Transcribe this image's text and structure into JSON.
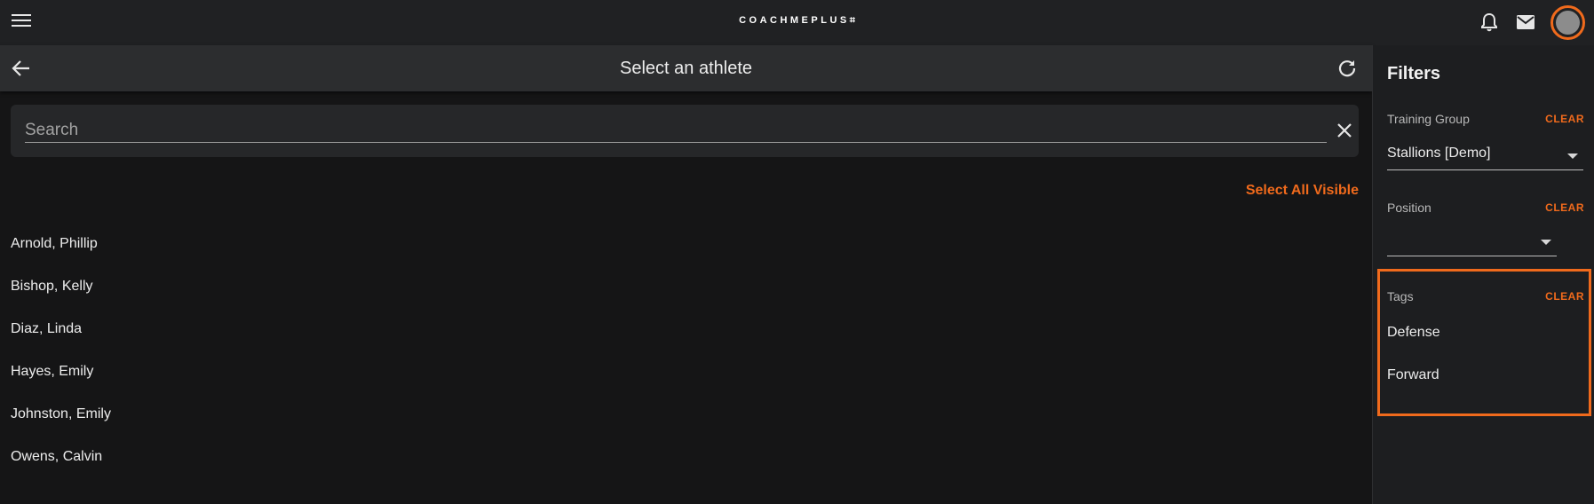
{
  "header": {
    "brand": "COACHMEPLUS",
    "brand_mark": "⌗",
    "icons": [
      "menu-icon",
      "bell-icon",
      "mail-icon",
      "avatar"
    ]
  },
  "subheader": {
    "title": "Select an athlete"
  },
  "search": {
    "placeholder": "Search",
    "value": ""
  },
  "select_all_label": "Select All Visible",
  "athletes": [
    "Arnold, Phillip",
    "Bishop, Kelly",
    "Diaz, Linda",
    "Hayes, Emily",
    "Johnston, Emily",
    "Owens, Calvin"
  ],
  "filters": {
    "title": "Filters",
    "clear_label": "CLEAR",
    "training_group": {
      "label": "Training Group",
      "value": "Stallions [Demo]"
    },
    "position": {
      "label": "Position",
      "value": ""
    },
    "tags": {
      "label": "Tags",
      "items": [
        "Defense",
        "Forward"
      ]
    }
  },
  "colors": {
    "accent": "#f06a1c",
    "background": "#151516",
    "topbar": "#202123",
    "panel": "#1d1e20"
  }
}
